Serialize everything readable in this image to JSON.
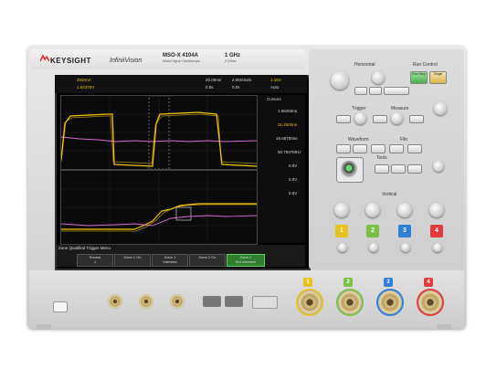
{
  "brand": {
    "name": "KEYSIGHT",
    "product": "InfiniiVision",
    "model": "MSO-X 4104A",
    "model_sub": "Mixed Signal Oscilloscope",
    "bandwidth": "1 GHz",
    "sample_rate": "5 GSa/s"
  },
  "status_bar": {
    "ch1_scale": "200mV/",
    "ch1_offset": "1.64375V",
    "timebase": "20.00ns/",
    "delay": "0.0s",
    "trig_sample": "2.00GSa/s",
    "trig_time": "0.0s",
    "trig_level": "1.16V",
    "mode": "Auto"
  },
  "side_panel": {
    "title": "Cursors",
    "x1": "1.56250ns",
    "x2": "21.2500ns",
    "dx": "19.68750ns",
    "inv_dx": "50.7937MHz",
    "y1": "0.0V",
    "y2": "0.0V",
    "dy": "0.0V"
  },
  "softkeys": {
    "menu_title": "Zone Qualified Trigger Menu",
    "items": [
      {
        "label": "Source",
        "value": "1"
      },
      {
        "label": "Zone 1 On",
        "value": ""
      },
      {
        "label": "Zone 1",
        "value": "Intersect"
      },
      {
        "label": "Zone 2 On",
        "value": ""
      },
      {
        "label": "Zone 2",
        "value": "Not Intersect"
      }
    ]
  },
  "controls": {
    "horizontal": "Horizontal",
    "run_control": "Run Control",
    "run_stop": "Run Stop",
    "single": "Single",
    "trigger": "Trigger",
    "measure": "Measure",
    "waveform": "Waveform",
    "tools": "Tools",
    "vertical": "Vertical",
    "file": "File"
  },
  "channels": [
    {
      "n": "1",
      "color": "#e7c21a"
    },
    {
      "n": "2",
      "color": "#7bc043"
    },
    {
      "n": "3",
      "color": "#2f7fd6"
    },
    {
      "n": "4",
      "color": "#e23b3b"
    }
  ],
  "colors": {
    "ch1": "#f0c400",
    "ch2": "#d86bd8",
    "screen": "#000000"
  }
}
